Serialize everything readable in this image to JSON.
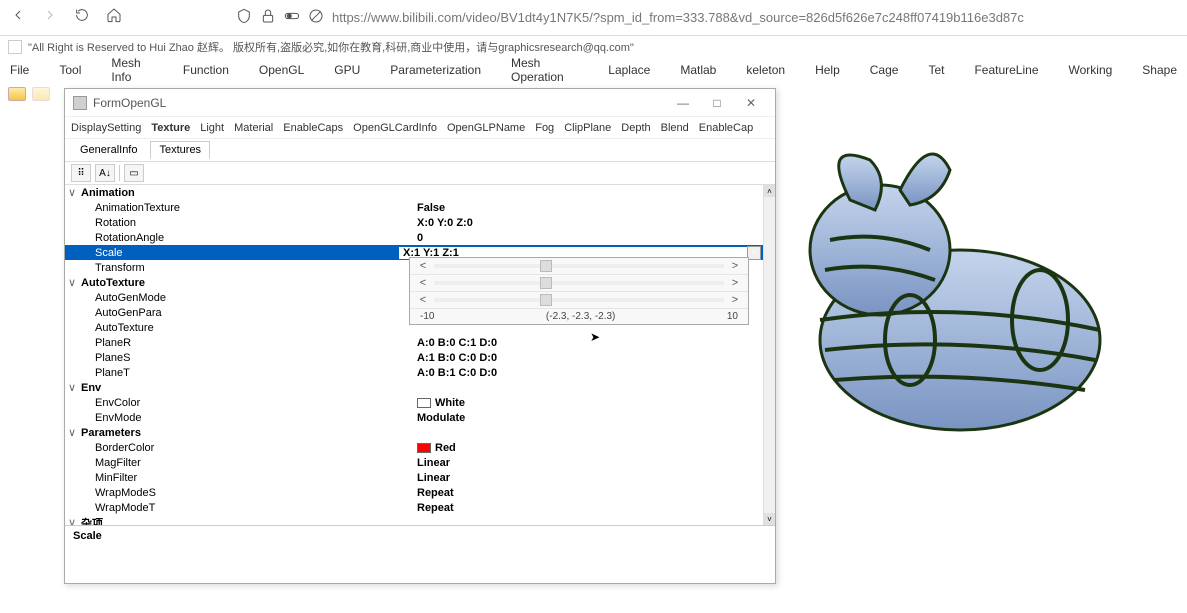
{
  "browser": {
    "url_display": "https://www.bilibili.com/video/BV1dt4y1N7K5/?spm_id_from=333.788&vd_source=826d5f626e7c248ff07419b116e3d87c"
  },
  "app": {
    "title_text": "\"All Right is Reserved to Hui Zhao 赵辉。 版权所有,盗版必究,如你在教育,科研,商业中使用，请与graphicsresearch@qq.com\""
  },
  "main_menu": [
    "File",
    "Tool",
    "Mesh Info",
    "Function",
    "OpenGL",
    "GPU",
    "Parameterization",
    "Mesh Operation",
    "Laplace",
    "Matlab",
    "keleton",
    "Help",
    "Cage",
    "Tet",
    "FeatureLine",
    "Working",
    "Shape"
  ],
  "form": {
    "title": "FormOpenGL",
    "win_min": "—",
    "win_max": "□",
    "win_close": "✕"
  },
  "inner_menu": [
    "DisplaySetting",
    "Texture",
    "Light",
    "Material",
    "EnableCaps",
    "OpenGLCardInfo",
    "OpenGLPName",
    "Fog",
    "ClipPlane",
    "Depth",
    "Blend",
    "EnableCap"
  ],
  "sub_tabs": {
    "a": "GeneralInfo",
    "b": "Textures"
  },
  "toolbar_btns": {
    "cat": "⠿",
    "az": "A↓",
    "page": "▭"
  },
  "categories": {
    "animation": "Animation",
    "autotexture": "AutoTexture",
    "env": "Env",
    "parameters": "Parameters",
    "misc": "杂项"
  },
  "props": {
    "animation_texture": {
      "label": "AnimationTexture",
      "value": "False"
    },
    "rotation": {
      "label": "Rotation",
      "value": "X:0 Y:0 Z:0"
    },
    "rotation_angle": {
      "label": "RotationAngle",
      "value": "0"
    },
    "scale": {
      "label": "Scale",
      "value": "X:1 Y:1 Z:1"
    },
    "transform": {
      "label": "Transform",
      "value": ""
    },
    "auto_gen_mode": {
      "label": "AutoGenMode",
      "value": ""
    },
    "auto_gen_para": {
      "label": "AutoGenPara",
      "value": ""
    },
    "auto_texture": {
      "label": "AutoTexture",
      "value": ""
    },
    "plane_r": {
      "label": "PlaneR",
      "value": "A:0 B:0 C:1 D:0"
    },
    "plane_s": {
      "label": "PlaneS",
      "value": "A:1 B:0 C:0 D:0"
    },
    "plane_t": {
      "label": "PlaneT",
      "value": "A:0 B:1 C:0 D:0"
    },
    "env_color": {
      "label": "EnvColor",
      "value": "White",
      "swatch": "#ffffff"
    },
    "env_mode": {
      "label": "EnvMode",
      "value": "Modulate"
    },
    "border_color": {
      "label": "BorderColor",
      "value": "Red",
      "swatch": "#ff0000"
    },
    "mag_filter": {
      "label": "MagFilter",
      "value": "Linear"
    },
    "min_filter": {
      "label": "MinFilter",
      "value": "Linear"
    },
    "wrap_mode_s": {
      "label": "WrapModeS",
      "value": "Repeat"
    },
    "wrap_mode_t": {
      "label": "WrapModeT",
      "value": "Repeat"
    }
  },
  "slider": {
    "left_arrow": "<",
    "right_arrow": ">",
    "min": "-10",
    "max": "10",
    "current": "(-2.3, -2.3, -2.3)"
  },
  "description": {
    "name": "Scale"
  },
  "expander": {
    "open": "∨",
    "right": ">"
  },
  "dropdown_glyph": "˅",
  "scroll": {
    "up": "˄",
    "down": "˅"
  }
}
